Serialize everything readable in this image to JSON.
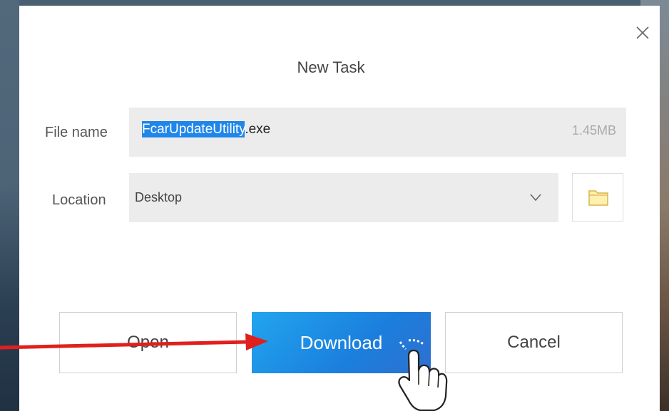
{
  "dialog": {
    "title": "New Task",
    "close_icon": "close-icon"
  },
  "file": {
    "label": "File name",
    "name_selected": "FcarUpdateUtility",
    "extension": ".exe",
    "size": "1.45MB"
  },
  "location": {
    "label": "Location",
    "value": "Desktop",
    "dropdown_icon": "chevron-down-icon",
    "browse_icon": "folder-icon"
  },
  "buttons": {
    "open": "Open",
    "download": "Download",
    "cancel": "Cancel"
  },
  "annotations": {
    "arrow": "red-arrow-icon",
    "cursor": "hand-pointer-icon"
  },
  "colors": {
    "selection": "#1f86ea",
    "primary_button": "#1b7fdd",
    "arrow": "#e0201c"
  }
}
